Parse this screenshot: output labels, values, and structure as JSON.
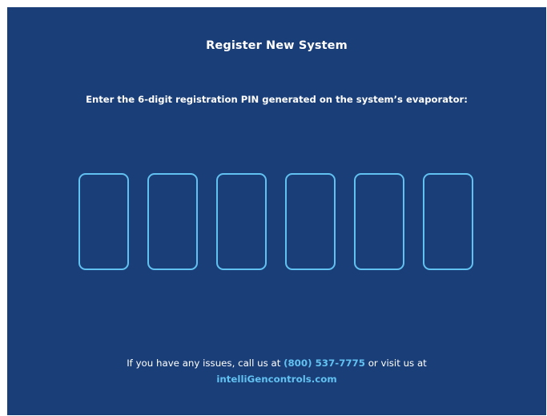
{
  "screen": {
    "title": "Register New System",
    "instruction": "Enter the 6-digit registration PIN generated on the system’s evaporator:"
  },
  "pin": {
    "digits": [
      "",
      "",
      "",
      "",
      "",
      ""
    ]
  },
  "footer": {
    "text_before_phone": "If you have any issues, call us at ",
    "phone": "(800) 537-7775",
    "text_after_phone": " or visit us at",
    "website": "intelliGencontrols.com"
  },
  "colors": {
    "background": "#1a3e78",
    "accent": "#61c1f1",
    "text": "#ffffff"
  }
}
